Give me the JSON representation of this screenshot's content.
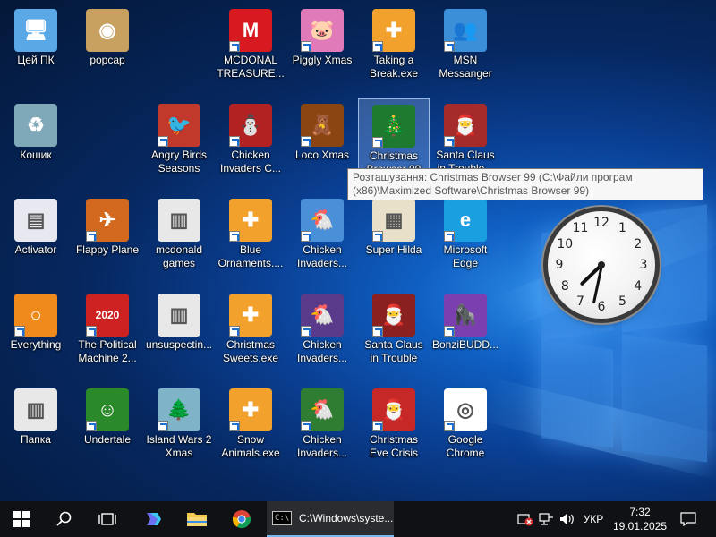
{
  "desktop": {
    "icons": [
      {
        "label": "Цей ПК",
        "icon": "this-pc-icon",
        "color": "#5aa8e6",
        "glyph": "🖥",
        "shortcut": false
      },
      {
        "label": "popcap",
        "icon": "popcap-folder-icon",
        "color": "#c8a060",
        "glyph": "◉",
        "shortcut": false
      },
      {
        "label": "MCDONAL TREASURE...",
        "icon": "mcdonalds-icon",
        "color": "#d71920",
        "glyph": "M",
        "shortcut": true
      },
      {
        "label": "Piggly Xmas",
        "icon": "pig-icon",
        "color": "#e07ab8",
        "glyph": "🐷",
        "shortcut": true
      },
      {
        "label": "Taking a Break.exe",
        "icon": "popcap-puzzle-icon",
        "color": "#f2a12c",
        "glyph": "✚",
        "shortcut": true
      },
      {
        "label": "MSN Messanger",
        "icon": "msn-icon",
        "color": "#3a8fd8",
        "glyph": "👥",
        "shortcut": true
      },
      {
        "label": "Кошик",
        "icon": "recycle-bin-icon",
        "color": "#7fa8b8",
        "glyph": "♻",
        "shortcut": false
      },
      {
        "label": "Angry Birds Seasons",
        "icon": "angry-birds-icon",
        "color": "#c0392b",
        "glyph": "🐦",
        "shortcut": true
      },
      {
        "label": "Chicken Invaders C...",
        "icon": "chicken-xmas-icon",
        "color": "#b22222",
        "glyph": "⛄",
        "shortcut": true
      },
      {
        "label": "Loco Xmas",
        "icon": "teddy-bear-icon",
        "color": "#8b4513",
        "glyph": "🧸",
        "shortcut": true
      },
      {
        "label": "Christmas Browser 99",
        "icon": "christmas-tree-icon",
        "color": "#1e7a2e",
        "glyph": "🎄",
        "shortcut": true
      },
      {
        "label": "Santa Claus in Trouble... A...",
        "icon": "santa-icon",
        "color": "#a52a2a",
        "glyph": "🎅",
        "shortcut": true
      },
      {
        "label": "Activator",
        "icon": "activator-file-icon",
        "color": "#e8e8f0",
        "glyph": "▤",
        "shortcut": false
      },
      {
        "label": "Flappy Plane",
        "icon": "flappy-plane-icon",
        "color": "#d2691e",
        "glyph": "✈",
        "shortcut": true
      },
      {
        "label": "mcdonald games",
        "icon": "folder-icon",
        "color": "#e8e8e8",
        "glyph": "▥",
        "shortcut": false
      },
      {
        "label": "Blue Ornaments....",
        "icon": "popcap-puzzle-icon",
        "color": "#f2a12c",
        "glyph": "✚",
        "shortcut": true
      },
      {
        "label": "Chicken Invaders...",
        "icon": "chicken-icon",
        "color": "#4a90d9",
        "glyph": "🐔",
        "shortcut": true
      },
      {
        "label": "Super Hilda",
        "icon": "super-hilda-icon",
        "color": "#e8e0c8",
        "glyph": "▦",
        "shortcut": true
      },
      {
        "label": "Microsoft Edge",
        "icon": "edge-icon",
        "color": "#1aa0e0",
        "glyph": "e",
        "shortcut": true
      },
      {
        "label": "Everything",
        "icon": "search-magnifier-icon",
        "color": "#f08a1c",
        "glyph": "○",
        "shortcut": true
      },
      {
        "label": "The Political Machine 2...",
        "icon": "political-machine-icon",
        "color": "#cc2222",
        "glyph": "2020",
        "shortcut": true
      },
      {
        "label": "unsuspectin...",
        "icon": "folder-icon",
        "color": "#e8e8e8",
        "glyph": "▥",
        "shortcut": false
      },
      {
        "label": "Christmas Sweets.exe",
        "icon": "popcap-puzzle-icon",
        "color": "#f2a12c",
        "glyph": "✚",
        "shortcut": true
      },
      {
        "label": "Chicken Invaders...",
        "icon": "chicken-space-icon",
        "color": "#5a3a8a",
        "glyph": "🐔",
        "shortcut": true
      },
      {
        "label": "Santa Claus in Trouble",
        "icon": "santa-icon",
        "color": "#8b2020",
        "glyph": "🎅",
        "shortcut": true
      },
      {
        "label": "BonziBUDD...",
        "icon": "bonzi-buddy-icon",
        "color": "#7b3fb0",
        "glyph": "🦍",
        "shortcut": true
      },
      {
        "label": "Папка",
        "icon": "folder-icon",
        "color": "#e8e8e8",
        "glyph": "▥",
        "shortcut": false
      },
      {
        "label": "Undertale",
        "icon": "undertale-icon",
        "color": "#2a8a2a",
        "glyph": "☺",
        "shortcut": true
      },
      {
        "label": "Island Wars 2 Xmas",
        "icon": "island-wars-icon",
        "color": "#7fb3c8",
        "glyph": "🌲",
        "shortcut": true
      },
      {
        "label": "Snow Animals.exe",
        "icon": "popcap-puzzle-icon",
        "color": "#f2a12c",
        "glyph": "✚",
        "shortcut": true
      },
      {
        "label": "Chicken Invaders...",
        "icon": "chicken-green-icon",
        "color": "#2e7d32",
        "glyph": "🐔",
        "shortcut": true
      },
      {
        "label": "Christmas Eve Crisis",
        "icon": "santa-face-icon",
        "color": "#c62828",
        "glyph": "🎅",
        "shortcut": true
      },
      {
        "label": "Google Chrome",
        "icon": "chrome-icon",
        "color": "#ffffff",
        "glyph": "◎",
        "shortcut": true
      }
    ]
  },
  "tooltip": {
    "text": "Розташування: Christmas Browser 99 (C:\\Файли програм (x86)\\Maximized Software\\Christmas Browser 99)"
  },
  "clock_widget": {
    "time": "7:32",
    "numbers": [
      "12",
      "1",
      "2",
      "3",
      "4",
      "5",
      "6",
      "7",
      "8",
      "9",
      "10",
      "11"
    ]
  },
  "taskbar": {
    "start_icon": "windows-start-icon",
    "search_icon": "search-icon",
    "task_view_icon": "task-view-icon",
    "pinned": [
      "copilot-icon",
      "file-explorer-icon",
      "chrome-icon"
    ],
    "running_task": "C:\\Windows\\syste...",
    "tray": {
      "language": "УКР",
      "time": "7:32",
      "date": "19.01.2025"
    }
  }
}
